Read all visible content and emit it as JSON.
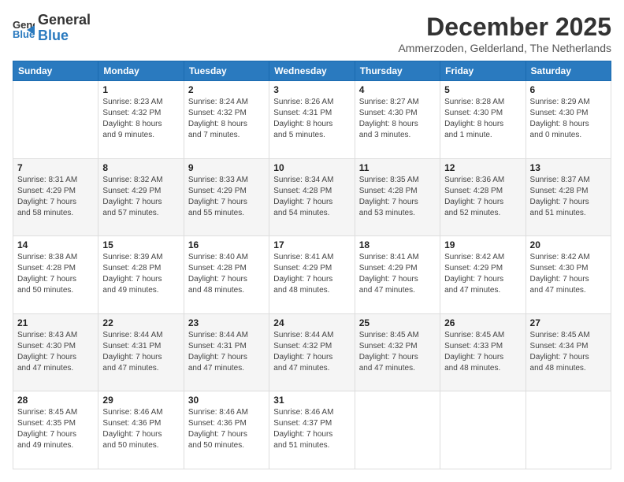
{
  "header": {
    "logo_line1": "General",
    "logo_line2": "Blue",
    "month_title": "December 2025",
    "location": "Ammerzoden, Gelderland, The Netherlands"
  },
  "days_of_week": [
    "Sunday",
    "Monday",
    "Tuesday",
    "Wednesday",
    "Thursday",
    "Friday",
    "Saturday"
  ],
  "weeks": [
    [
      {
        "day": "",
        "info": ""
      },
      {
        "day": "1",
        "info": "Sunrise: 8:23 AM\nSunset: 4:32 PM\nDaylight: 8 hours\nand 9 minutes."
      },
      {
        "day": "2",
        "info": "Sunrise: 8:24 AM\nSunset: 4:32 PM\nDaylight: 8 hours\nand 7 minutes."
      },
      {
        "day": "3",
        "info": "Sunrise: 8:26 AM\nSunset: 4:31 PM\nDaylight: 8 hours\nand 5 minutes."
      },
      {
        "day": "4",
        "info": "Sunrise: 8:27 AM\nSunset: 4:30 PM\nDaylight: 8 hours\nand 3 minutes."
      },
      {
        "day": "5",
        "info": "Sunrise: 8:28 AM\nSunset: 4:30 PM\nDaylight: 8 hours\nand 1 minute."
      },
      {
        "day": "6",
        "info": "Sunrise: 8:29 AM\nSunset: 4:30 PM\nDaylight: 8 hours\nand 0 minutes."
      }
    ],
    [
      {
        "day": "7",
        "info": "Sunrise: 8:31 AM\nSunset: 4:29 PM\nDaylight: 7 hours\nand 58 minutes."
      },
      {
        "day": "8",
        "info": "Sunrise: 8:32 AM\nSunset: 4:29 PM\nDaylight: 7 hours\nand 57 minutes."
      },
      {
        "day": "9",
        "info": "Sunrise: 8:33 AM\nSunset: 4:29 PM\nDaylight: 7 hours\nand 55 minutes."
      },
      {
        "day": "10",
        "info": "Sunrise: 8:34 AM\nSunset: 4:28 PM\nDaylight: 7 hours\nand 54 minutes."
      },
      {
        "day": "11",
        "info": "Sunrise: 8:35 AM\nSunset: 4:28 PM\nDaylight: 7 hours\nand 53 minutes."
      },
      {
        "day": "12",
        "info": "Sunrise: 8:36 AM\nSunset: 4:28 PM\nDaylight: 7 hours\nand 52 minutes."
      },
      {
        "day": "13",
        "info": "Sunrise: 8:37 AM\nSunset: 4:28 PM\nDaylight: 7 hours\nand 51 minutes."
      }
    ],
    [
      {
        "day": "14",
        "info": "Sunrise: 8:38 AM\nSunset: 4:28 PM\nDaylight: 7 hours\nand 50 minutes."
      },
      {
        "day": "15",
        "info": "Sunrise: 8:39 AM\nSunset: 4:28 PM\nDaylight: 7 hours\nand 49 minutes."
      },
      {
        "day": "16",
        "info": "Sunrise: 8:40 AM\nSunset: 4:28 PM\nDaylight: 7 hours\nand 48 minutes."
      },
      {
        "day": "17",
        "info": "Sunrise: 8:41 AM\nSunset: 4:29 PM\nDaylight: 7 hours\nand 48 minutes."
      },
      {
        "day": "18",
        "info": "Sunrise: 8:41 AM\nSunset: 4:29 PM\nDaylight: 7 hours\nand 47 minutes."
      },
      {
        "day": "19",
        "info": "Sunrise: 8:42 AM\nSunset: 4:29 PM\nDaylight: 7 hours\nand 47 minutes."
      },
      {
        "day": "20",
        "info": "Sunrise: 8:42 AM\nSunset: 4:30 PM\nDaylight: 7 hours\nand 47 minutes."
      }
    ],
    [
      {
        "day": "21",
        "info": "Sunrise: 8:43 AM\nSunset: 4:30 PM\nDaylight: 7 hours\nand 47 minutes."
      },
      {
        "day": "22",
        "info": "Sunrise: 8:44 AM\nSunset: 4:31 PM\nDaylight: 7 hours\nand 47 minutes."
      },
      {
        "day": "23",
        "info": "Sunrise: 8:44 AM\nSunset: 4:31 PM\nDaylight: 7 hours\nand 47 minutes."
      },
      {
        "day": "24",
        "info": "Sunrise: 8:44 AM\nSunset: 4:32 PM\nDaylight: 7 hours\nand 47 minutes."
      },
      {
        "day": "25",
        "info": "Sunrise: 8:45 AM\nSunset: 4:32 PM\nDaylight: 7 hours\nand 47 minutes."
      },
      {
        "day": "26",
        "info": "Sunrise: 8:45 AM\nSunset: 4:33 PM\nDaylight: 7 hours\nand 48 minutes."
      },
      {
        "day": "27",
        "info": "Sunrise: 8:45 AM\nSunset: 4:34 PM\nDaylight: 7 hours\nand 48 minutes."
      }
    ],
    [
      {
        "day": "28",
        "info": "Sunrise: 8:45 AM\nSunset: 4:35 PM\nDaylight: 7 hours\nand 49 minutes."
      },
      {
        "day": "29",
        "info": "Sunrise: 8:46 AM\nSunset: 4:36 PM\nDaylight: 7 hours\nand 50 minutes."
      },
      {
        "day": "30",
        "info": "Sunrise: 8:46 AM\nSunset: 4:36 PM\nDaylight: 7 hours\nand 50 minutes."
      },
      {
        "day": "31",
        "info": "Sunrise: 8:46 AM\nSunset: 4:37 PM\nDaylight: 7 hours\nand 51 minutes."
      },
      {
        "day": "",
        "info": ""
      },
      {
        "day": "",
        "info": ""
      },
      {
        "day": "",
        "info": ""
      }
    ]
  ]
}
